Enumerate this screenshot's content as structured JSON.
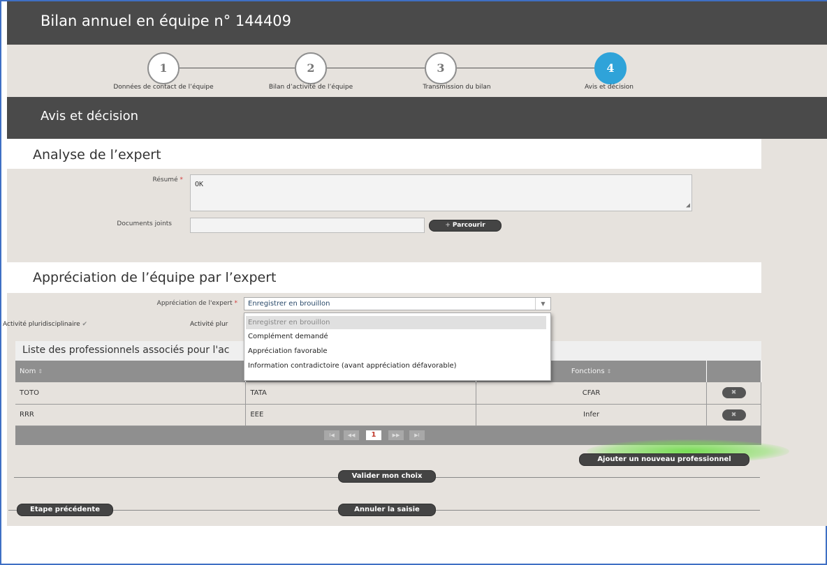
{
  "header": {
    "title": "Bilan annuel en équipe n° 144409"
  },
  "stepper": {
    "steps": [
      {
        "number": "1",
        "label": "Données de contact de l’équipe"
      },
      {
        "number": "2",
        "label": "Bilan d’activité de l’équipe"
      },
      {
        "number": "3",
        "label": "Transmission du bilan"
      },
      {
        "number": "4",
        "label": "Avis et décision"
      }
    ]
  },
  "section": {
    "title": "Avis et décision"
  },
  "analyse": {
    "title": "Analyse de l’expert",
    "resume_label": "Résumé",
    "required_mark": "*",
    "resume_value": "OK",
    "documents_label": "Documents joints",
    "browse_icon": "+",
    "browse_label": "Parcourir"
  },
  "appreciation": {
    "title": "Appréciation de l’équipe par l’expert",
    "select_label": "Appréciation de l'expert",
    "required_mark": "*",
    "select_value": "Enregistrer en brouillon",
    "select_arrow": "▼",
    "options": [
      "Enregistrer en brouillon",
      "Complément demandé",
      "Appréciation favorable",
      "Information contradictoire (avant appréciation défavorable)"
    ],
    "checkbox1_label": "Activité pluridisciplinaire",
    "checkbox_mark": "✔",
    "checkbox2_label": "Activité plur",
    "list_title": "Liste des professionnels associés pour l'ac"
  },
  "table": {
    "sort_icon": "⇕",
    "headers": [
      "Nom",
      "Fonctions"
    ],
    "rows": [
      {
        "nom": "TOTO",
        "prenom": "TATA",
        "fonction": "CFAR"
      },
      {
        "nom": "RRR",
        "prenom": "EEE",
        "fonction": "Infer"
      }
    ],
    "delete_icon": "✖",
    "pager": {
      "first": "I◀",
      "prev": "◀◀",
      "current": "1",
      "next": "▶▶",
      "last": "▶I"
    }
  },
  "actions": {
    "add_professional": "Ajouter un nouveau professionnel",
    "validate": "Valider mon choix",
    "previous_step": "Etape précédente",
    "cancel": "Annuler la saisie"
  },
  "colors": {
    "header_bg": "#4a4a4a",
    "panel_bg": "#e6e2dd",
    "active_step": "#2fa3d9",
    "accent_glow": "#64dc3c"
  }
}
